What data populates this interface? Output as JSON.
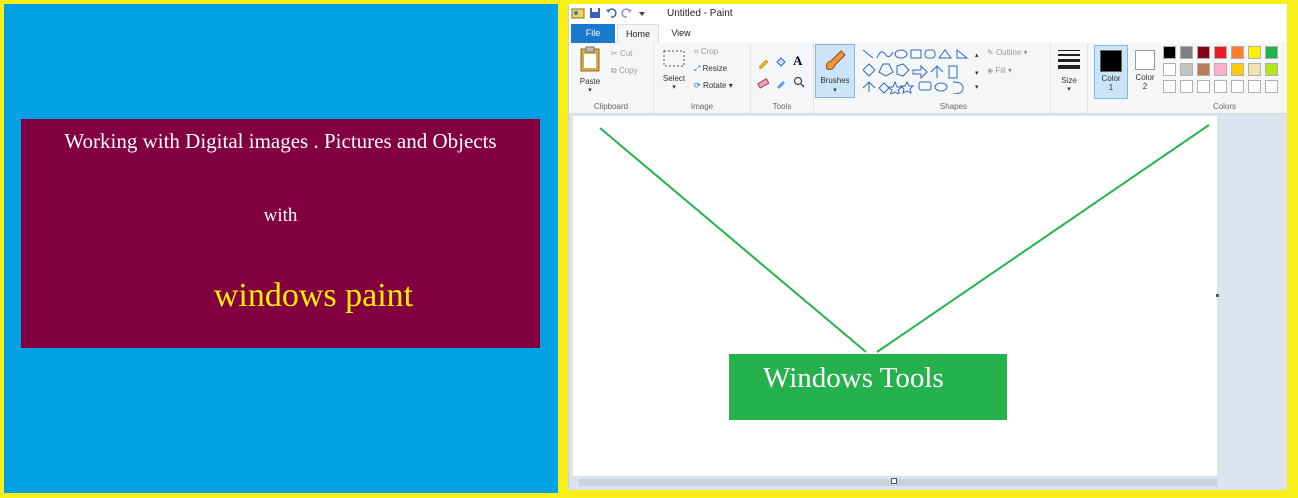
{
  "left": {
    "line1": "Working with Digital images . Pictures and Objects",
    "line2": "with",
    "line3": "windows paint"
  },
  "paint": {
    "window_title": "Untitled - Paint",
    "tabs": [
      "File",
      "Home",
      "View"
    ],
    "clipboard": {
      "paste": "Paste",
      "cut": "Cut",
      "copy": "Copy",
      "label": "Clipboard"
    },
    "image": {
      "select": "Select",
      "crop": "Crop",
      "resize": "Resize",
      "rotate": "Rotate",
      "label": "Image"
    },
    "tools": {
      "label": "Tools"
    },
    "brushes": {
      "label": "Brushes"
    },
    "shapes": {
      "outline": "Outline",
      "fill": "Fill",
      "label": "Shapes"
    },
    "size": {
      "label": "Size"
    },
    "color1": "Color 1",
    "color2": "Color 2",
    "colors": {
      "label": "Colors",
      "row1": [
        "#000000",
        "#7f7f7f",
        "#880015",
        "#ed1c24",
        "#ff7f27",
        "#fff200",
        "#22b14c"
      ],
      "row2": [
        "#ffffff",
        "#c3c3c3",
        "#b97a57",
        "#ffaec9",
        "#ffc90e",
        "#efe4b0",
        "#b5e61d"
      ]
    },
    "canvas_label": "Windows Tools"
  },
  "accent": {
    "panel_blue": "#00a1e4",
    "card": "#820040",
    "yellow": "#f7ee1a",
    "green": "#25b24d"
  }
}
